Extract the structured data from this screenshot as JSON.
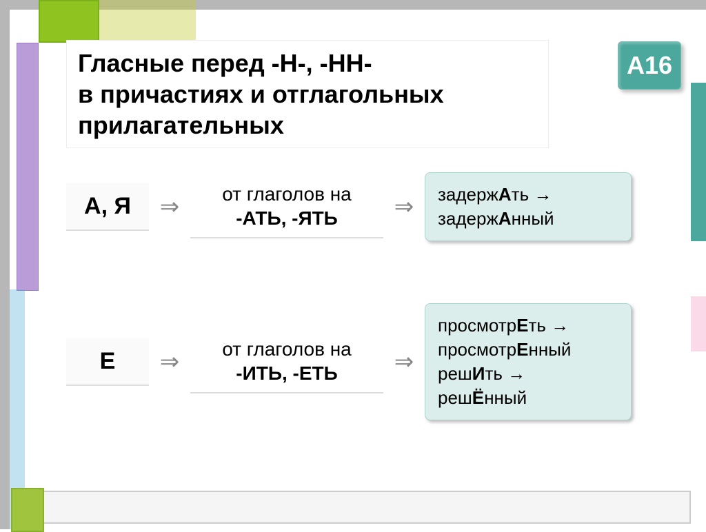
{
  "badge": "А16",
  "title": "Гласные перед  -Н-, -НН-\nв причастиях и отглагольных прилагательных",
  "rows": [
    {
      "vowels": "А, Я",
      "rule_prefix": "от глаголов на",
      "rule_suffix": "-АТЬ, -ЯТЬ",
      "examples_html": "задерж<span class='hi'>А</span>ть →<br>задерж<span class='hi'>А</span>нный"
    },
    {
      "vowels": "Е",
      "rule_prefix": "от глаголов на",
      "rule_suffix": "-ИТЬ, -ЕТЬ",
      "examples_html": "просмотр<span class='hi'>Е</span>ть →<br>просмотр<span class='hi'>Е</span>нный<br>реш<span class='hi'>И</span>ть →<br>реш<span class='hi'>Ё</span>нный"
    }
  ]
}
